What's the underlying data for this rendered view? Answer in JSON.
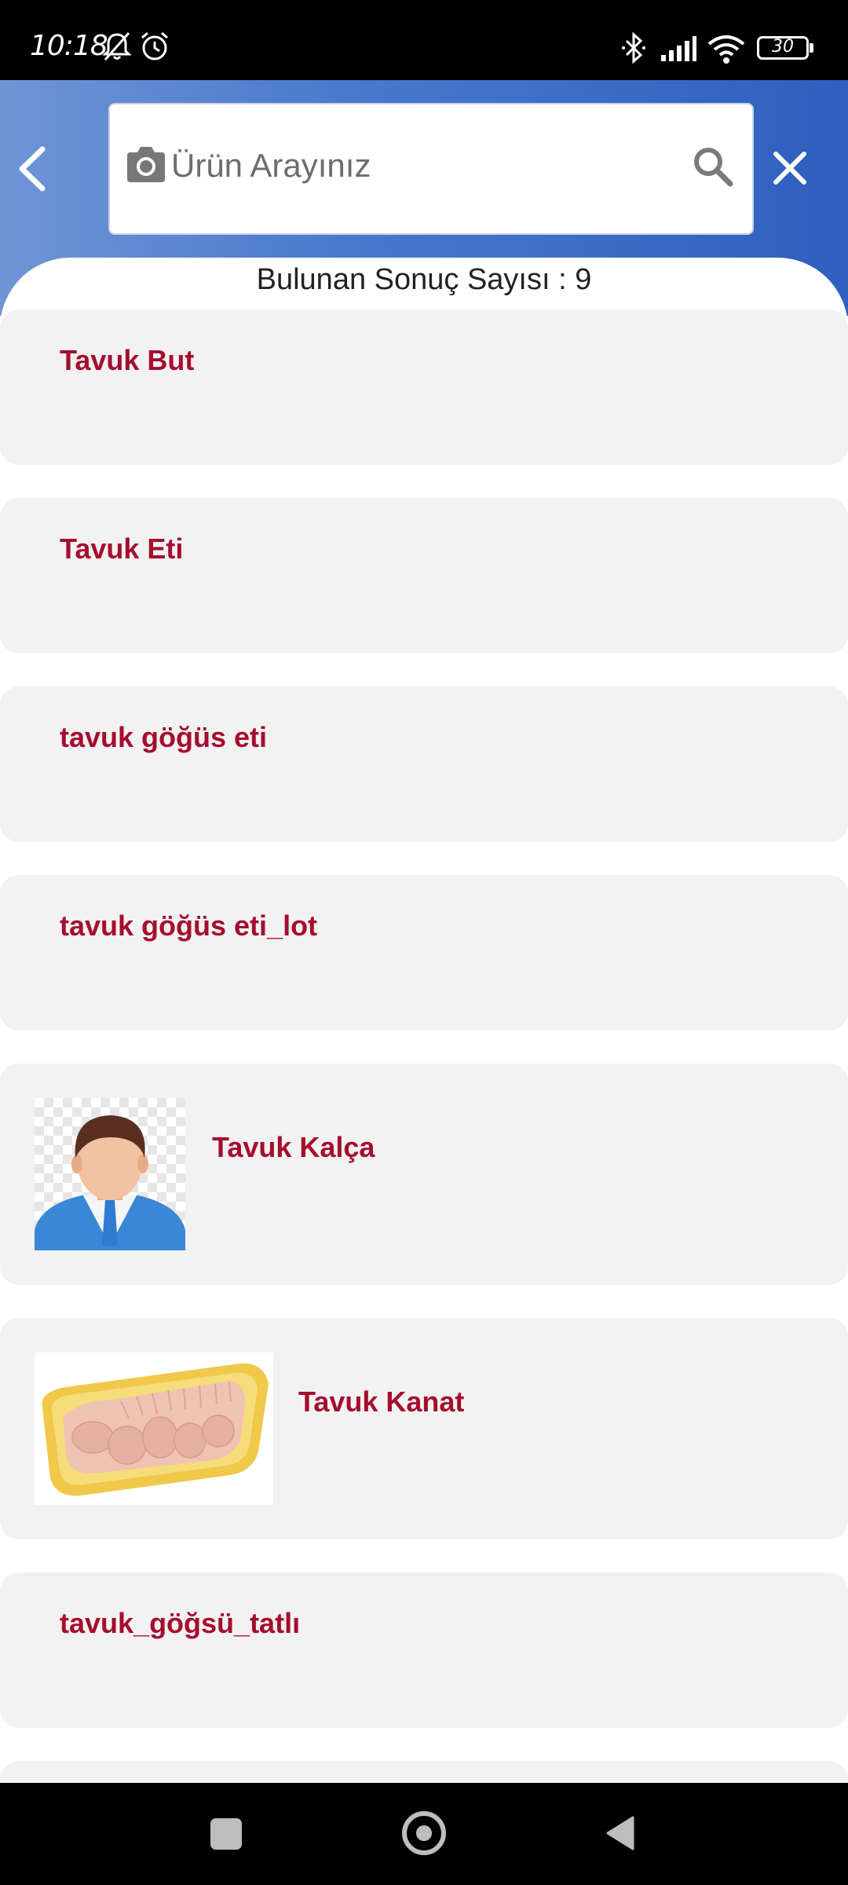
{
  "status_bar": {
    "time": "10:18",
    "battery": "30",
    "icons": [
      "mute-bell-icon",
      "alarm-icon",
      "bluetooth-icon",
      "signal-icon",
      "wifi-icon",
      "battery-icon"
    ]
  },
  "header": {
    "back_icon": "chevron-left-icon",
    "camera_icon": "camera-icon",
    "search_icon": "search-icon",
    "close_icon": "close-icon",
    "search_placeholder": "Ürün Arayınız",
    "search_value": ""
  },
  "results": {
    "count_text": "Bulunan Sonuç Sayısı : 9",
    "items": [
      {
        "title": "Tavuk But",
        "image": null
      },
      {
        "title": "Tavuk Eti",
        "image": null
      },
      {
        "title": "tavuk göğüs eti",
        "image": null
      },
      {
        "title": "tavuk göğüs eti_lot",
        "image": null
      },
      {
        "title": "Tavuk Kalça",
        "image": "person-avatar-placeholder"
      },
      {
        "title": "Tavuk Kanat",
        "image": "chicken-wings-tray-photo"
      },
      {
        "title": "tavuk_göğsü_tatlı",
        "image": null
      }
    ]
  },
  "nav_bar": {
    "icons": [
      "recents-icon",
      "home-icon",
      "back-icon"
    ]
  },
  "colors": {
    "header_gradient_start": "#6f95d6",
    "header_gradient_end": "#2f5fbf",
    "item_title": "#a50c2d",
    "card_bg": "#f2f2f2"
  }
}
